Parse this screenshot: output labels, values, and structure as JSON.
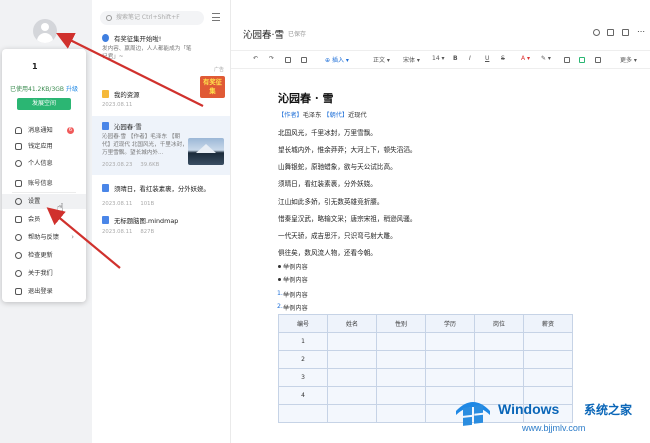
{
  "profile": {
    "username": "1",
    "storage_text": "已使用41.2KB/3GB",
    "upgrade_label": "升级",
    "expand_label": "发展空间"
  },
  "menu": [
    {
      "label": "消息通知",
      "badge": "6",
      "icon": "bell-icon"
    },
    {
      "label": "钱定应用",
      "icon": "app-icon"
    },
    {
      "label": "个人信息",
      "icon": "user-icon"
    },
    {
      "label": "账号信息",
      "icon": "account-icon"
    },
    {
      "label": "设置",
      "icon": "gear-icon"
    },
    {
      "label": "会员",
      "icon": "vip-icon"
    },
    {
      "label": "帮助与反馈",
      "icon": "help-icon",
      "has_submenu": true
    },
    {
      "label": "检查更新",
      "icon": "update-icon"
    },
    {
      "label": "关于我们",
      "icon": "info-icon"
    },
    {
      "label": "退出登录",
      "icon": "logout-icon"
    }
  ],
  "search": {
    "placeholder": "搜索笔记 Ctrl+Shift+F"
  },
  "notes": [
    {
      "title": "有奖征集开始啦!",
      "preview": "发内容、赢周边，人人都能成为「笔记君」~",
      "meta_tail": "广告",
      "icon": "bookmark-icon",
      "ad_text": "有奖征集",
      "ad_tag": "广告"
    },
    {
      "title": "我的资源",
      "date": "2023.08.11",
      "icon": "folder-icon"
    },
    {
      "title": "沁园春·雪",
      "preview": "沁园春·雪 【作者】毛泽东 【朝代】近现代 北国风光，千里冰封，万里雪飘。望长城内外...",
      "date": "2023.08.23",
      "size": "39.6KB",
      "icon": "doc-icon"
    },
    {
      "title": "须晴日，看红装素裹，分外妖娆。",
      "date": "2023.08.11",
      "size": "101B",
      "icon": "doc-icon"
    },
    {
      "title": "无标题脑图.mindmap",
      "date": "2023.08.11",
      "size": "827B",
      "icon": "mindmap-icon"
    }
  ],
  "editor": {
    "title": "沁园春·雪",
    "saved": "已保存",
    "toolbar": {
      "insert": "插入",
      "body": "正文",
      "font": "宋体",
      "size": "14",
      "more": "更多"
    },
    "doc_heading": "沁园春 · 雪",
    "author_line": {
      "a1": "【作者】",
      "a2": "毛泽东",
      "a3": "【朝代】",
      "a4": "近现代"
    },
    "lines": [
      "北国风光，千里冰封，万里雪飘。",
      "望长城内外，惟余莽莽；大河上下，顿失滔滔。",
      "山舞银蛇，原驰蜡象，欲与天公试比高。",
      "须晴日，看红装素裹，分外妖娆。",
      "江山如此多娇，引无数英雄竞折腰。",
      "惜秦皇汉武，略输文采；唐宗宋祖，稍逊风骚。",
      "一代天骄，成吉思汗，只识弯弓射大雕。",
      "俱往矣，数风流人物，还看今朝。"
    ],
    "bullets": [
      "举例内容",
      "举例内容"
    ],
    "numbered": [
      {
        "n": "1.",
        "t": "举例内容"
      },
      {
        "n": "2.",
        "t": "举例内容"
      }
    ],
    "table": {
      "headers": [
        "编号",
        "姓名",
        "性别",
        "学历",
        "岗位",
        "薪资"
      ],
      "rows": [
        "1",
        "2",
        "3",
        "4",
        ""
      ]
    }
  },
  "watermark": {
    "brand": "Windows",
    "cn": "系统之家",
    "url": "www.bjjmlv.com"
  },
  "colors": {
    "accent": "#2bb673",
    "link": "#1e6fd8",
    "arrow": "#d0312d"
  }
}
